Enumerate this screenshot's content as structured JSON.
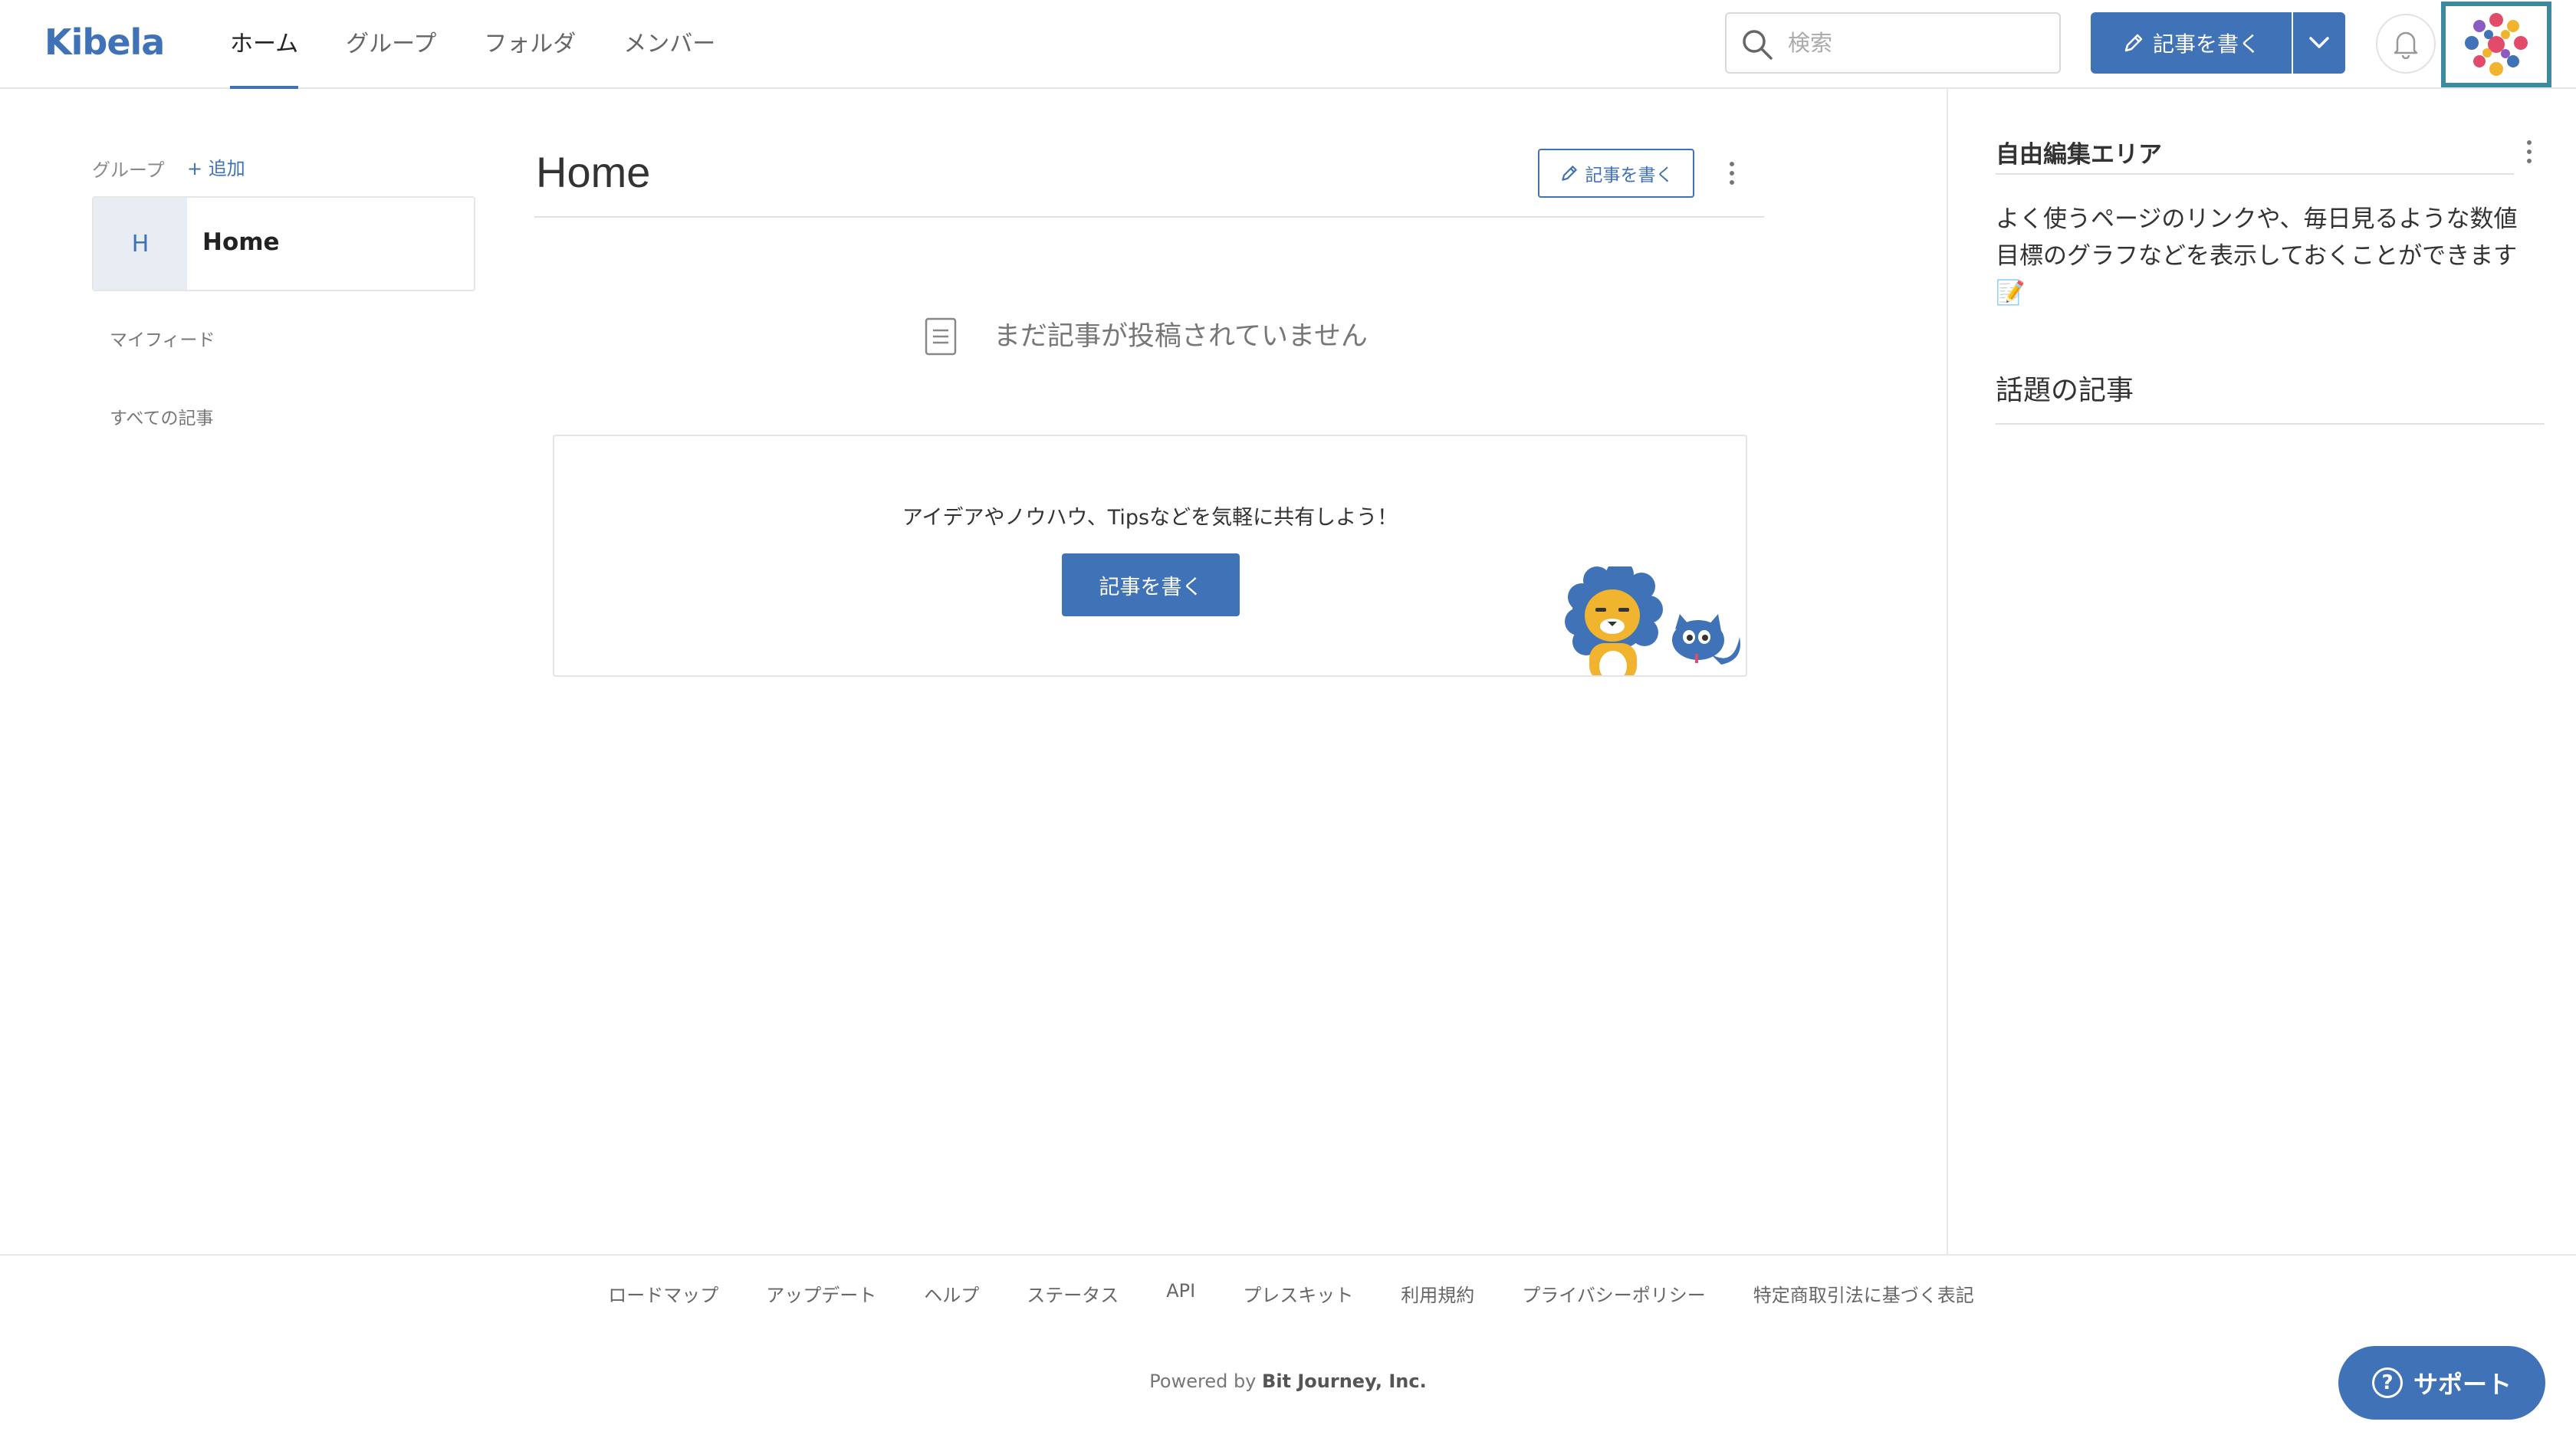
{
  "header": {
    "logo": "Kibela",
    "nav": [
      {
        "label": "ホーム",
        "active": true
      },
      {
        "label": "グループ",
        "active": false
      },
      {
        "label": "フォルダ",
        "active": false
      },
      {
        "label": "メンバー",
        "active": false
      }
    ],
    "search_placeholder": "検索",
    "write_button": "記事を書く",
    "icons": {
      "search": "search-icon",
      "pencil": "pencil-icon",
      "caret": "chevron-down-icon",
      "bell": "bell-icon",
      "avatar": "avatar"
    },
    "accent_color": "#3f72b6"
  },
  "sidebar": {
    "group_label": "グループ",
    "add_label": "+ 追加",
    "group": {
      "initial": "H",
      "name": "Home"
    },
    "links": [
      "マイフィード",
      "すべての記事"
    ]
  },
  "main": {
    "title": "Home",
    "write_button": "記事を書く",
    "empty_message": "まだ記事が投稿されていません",
    "prompt_text": "アイデアやノウハウ、Tipsなどを気軽に共有しよう！",
    "prompt_button": "記事を書く"
  },
  "right": {
    "free_area_title": "自由編集エリア",
    "free_area_text": "よく使うページのリンクや、毎日見るような数値目標のグラフなどを表示しておくことができます 📝",
    "trending_title": "話題の記事"
  },
  "footer": {
    "links": [
      "ロードマップ",
      "アップデート",
      "ヘルプ",
      "ステータス",
      "API",
      "プレスキット",
      "利用規約",
      "プライバシーポリシー",
      "特定商取引法に基づく表記"
    ],
    "powered_prefix": "Powered by",
    "powered_company": "Bit Journey, Inc."
  },
  "support_button": "サポート"
}
